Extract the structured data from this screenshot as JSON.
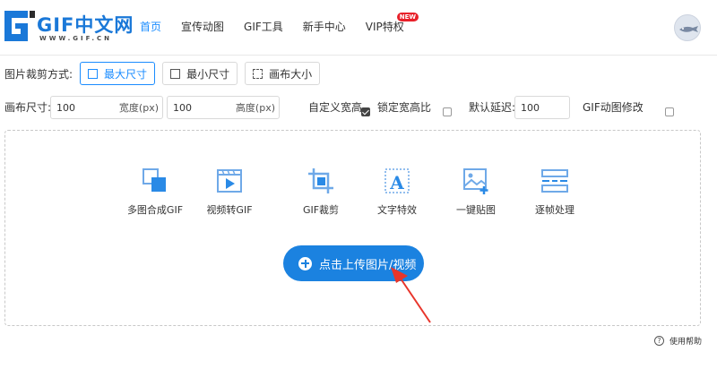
{
  "logo": {
    "main": "GIF中文网",
    "sub": "WWW.GIF.CN"
  },
  "nav": {
    "items": [
      {
        "label": "首页",
        "active": true
      },
      {
        "label": "宣传动图",
        "active": false
      },
      {
        "label": "GIF工具",
        "active": false
      },
      {
        "label": "新手中心",
        "active": false
      },
      {
        "label": "VIP特权",
        "active": false,
        "badge": "NEW"
      }
    ]
  },
  "crop": {
    "label": "图片裁剪方式:",
    "options": [
      {
        "label": "最大尺寸",
        "icon": "max-size-icon",
        "active": true
      },
      {
        "label": "最小尺寸",
        "icon": "min-size-icon",
        "active": false
      },
      {
        "label": "画布大小",
        "icon": "canvas-size-icon",
        "active": false
      }
    ]
  },
  "canvas": {
    "label": "画布尺寸:",
    "width_value": "100",
    "width_unit": "宽度(px)",
    "height_value": "100",
    "height_unit": "高度(px)",
    "custom_label": "自定义宽高",
    "custom_checked": true,
    "lock_label": "锁定宽高比",
    "lock_checked": false,
    "delay_label": "默认延迟:",
    "delay_value": "100",
    "gif_edit_label": "GIF动图修改",
    "gif_edit_checked": false
  },
  "tools": [
    {
      "label": "多图合成GIF",
      "icon": "merge-images-icon"
    },
    {
      "label": "视频转GIF",
      "icon": "video-to-gif-icon"
    },
    {
      "label": "GIF裁剪",
      "icon": "crop-icon"
    },
    {
      "label": "文字特效",
      "icon": "text-effect-icon"
    },
    {
      "label": "一键贴图",
      "icon": "add-image-icon"
    },
    {
      "label": "逐帧处理",
      "icon": "frame-by-frame-icon"
    }
  ],
  "upload": {
    "label": "点击上传图片/视频"
  },
  "help": {
    "label": "使用帮助"
  },
  "colors": {
    "accent": "#1a8cff",
    "upload_button": "#1b82e0",
    "badge": "#e8212a",
    "arrow": "#e8352b"
  }
}
